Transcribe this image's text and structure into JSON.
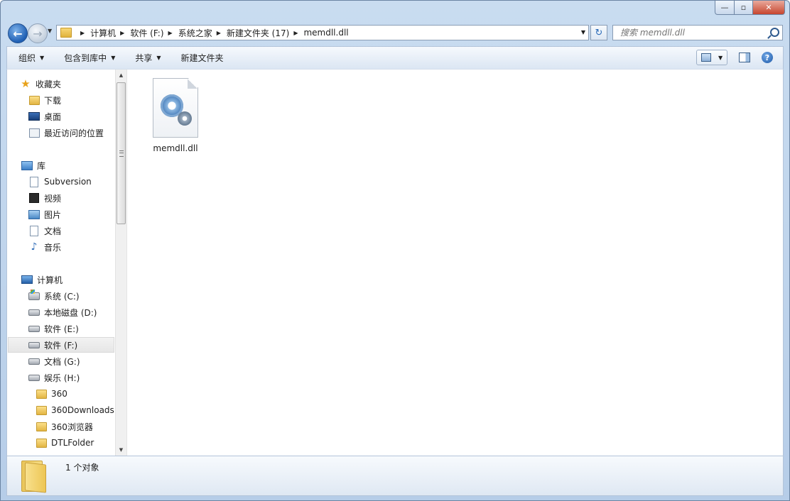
{
  "window": {
    "controls": {
      "minimize": "—",
      "maximize": "▫",
      "close": "✕"
    }
  },
  "address": {
    "back_glyph": "←",
    "forward_glyph": "→",
    "breadcrumbs": [
      "计算机",
      "软件 (F:)",
      "系统之家",
      "新建文件夹 (17)",
      "memdll.dll"
    ],
    "refresh_glyph": "↻"
  },
  "search": {
    "placeholder": "搜索 memdll.dll"
  },
  "toolbar": {
    "organize": "组织",
    "include_in_library": "包含到库中",
    "share": "共享",
    "new_folder": "新建文件夹",
    "help": "?"
  },
  "sidebar": {
    "favorites": {
      "label": "收藏夹",
      "items": [
        "下载",
        "桌面",
        "最近访问的位置"
      ]
    },
    "libraries": {
      "label": "库",
      "items": [
        "Subversion",
        "视频",
        "图片",
        "文档",
        "音乐"
      ]
    },
    "computer": {
      "label": "计算机",
      "drives": [
        "系统 (C:)",
        "本地磁盘 (D:)",
        "软件 (E:)",
        "软件 (F:)",
        "文档 (G:)",
        "娱乐 (H:)"
      ],
      "folders": [
        "360",
        "360Downloads",
        "360浏览器",
        "DTLFolder"
      ]
    },
    "selected": "软件 (F:)"
  },
  "files": [
    {
      "name": "memdll.dll",
      "icon": "dll-gear-icon"
    }
  ],
  "details": {
    "status": "1 个对象"
  },
  "colors": {
    "accent": "#2a6ab8",
    "frame": "#b6cde8"
  }
}
